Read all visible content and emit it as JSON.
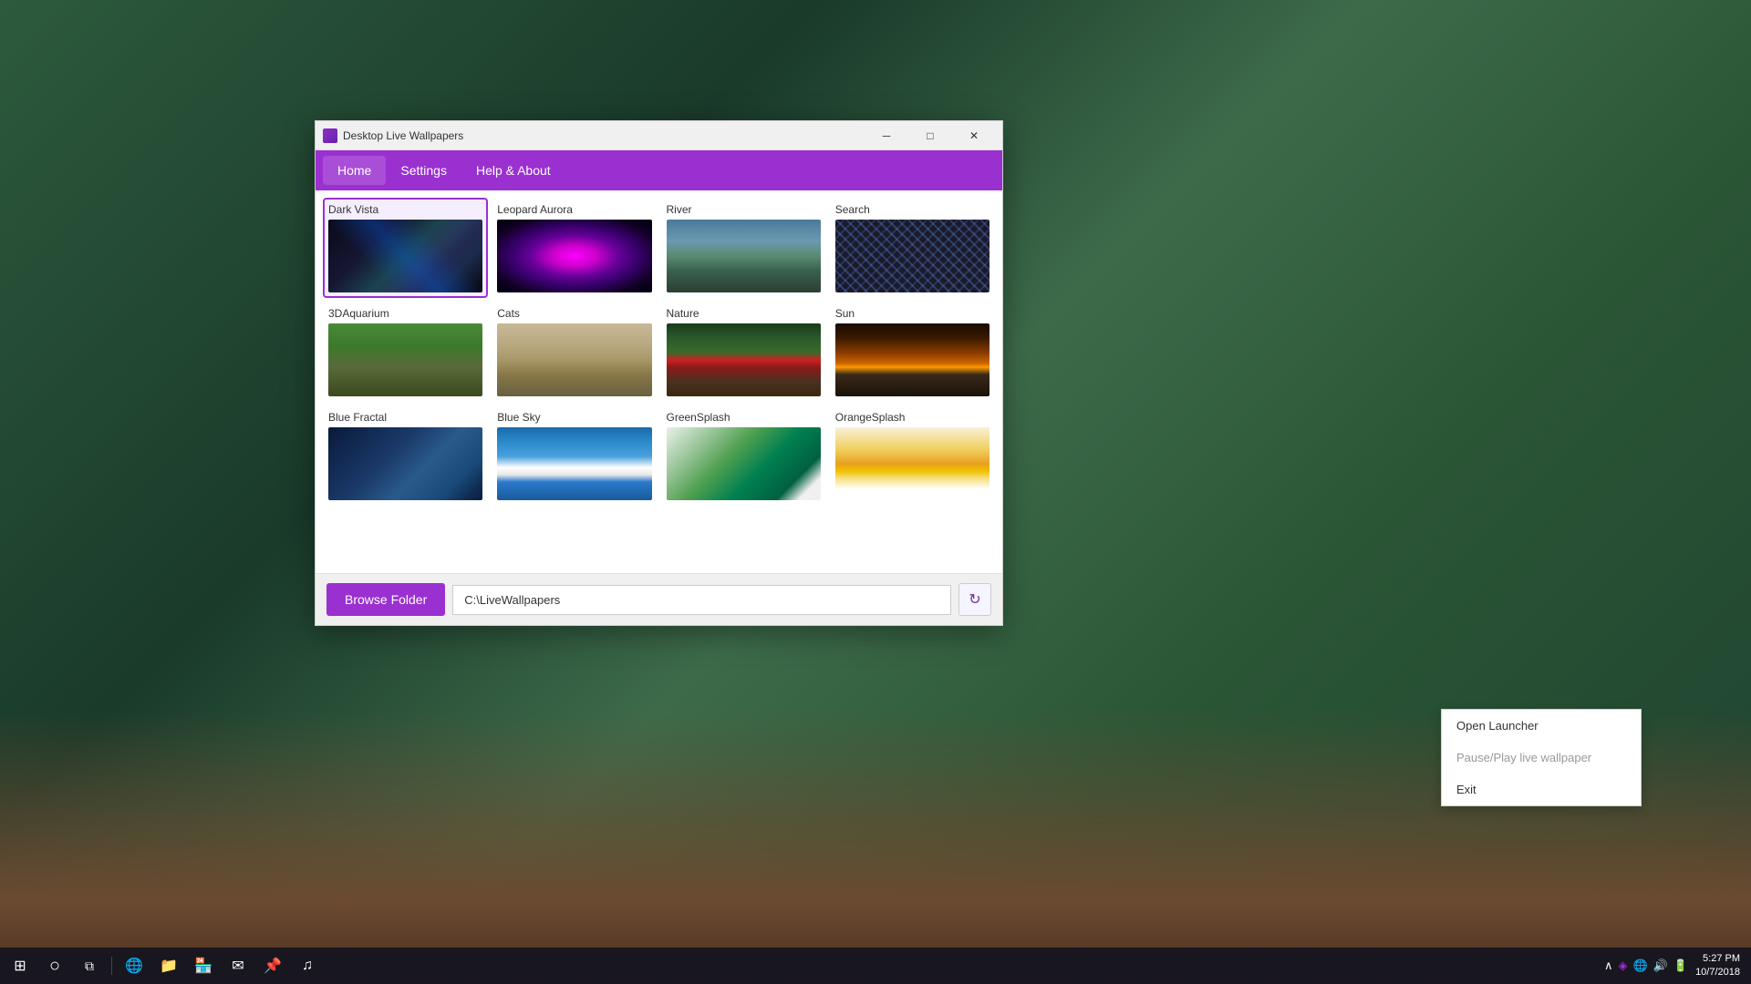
{
  "app": {
    "title": "Desktop Live Wallpapers",
    "title_icon": "wallpaper-icon"
  },
  "nav": {
    "items": [
      {
        "label": "Home",
        "id": "home",
        "active": true
      },
      {
        "label": "Settings",
        "id": "settings",
        "active": false
      },
      {
        "label": "Help & About",
        "id": "help",
        "active": false
      }
    ]
  },
  "wallpapers": [
    {
      "name": "Dark Vista",
      "thumb_class": "thumb-dark-vista"
    },
    {
      "name": "Leopard Aurora",
      "thumb_class": "thumb-leopard-aurora"
    },
    {
      "name": "River",
      "thumb_class": "thumb-river"
    },
    {
      "name": "Search",
      "thumb_class": "thumb-search"
    },
    {
      "name": "3DAquarium",
      "thumb_class": "thumb-3daquarium"
    },
    {
      "name": "Cats",
      "thumb_class": "thumb-cats"
    },
    {
      "name": "Nature",
      "thumb_class": "thumb-nature"
    },
    {
      "name": "Sun",
      "thumb_class": "thumb-sun"
    },
    {
      "name": "Blue Fractal",
      "thumb_class": "thumb-blue-fractal"
    },
    {
      "name": "Blue Sky",
      "thumb_class": "thumb-blue-sky"
    },
    {
      "name": "GreenSplash",
      "thumb_class": "thumb-greensplash"
    },
    {
      "name": "OrangeSplash",
      "thumb_class": "thumb-orangesplash"
    }
  ],
  "bottom_bar": {
    "browse_label": "Browse Folder",
    "path_value": "C:\\LiveWallpapers",
    "path_placeholder": "C:\\LiveWallpapers",
    "refresh_icon": "↻"
  },
  "context_menu": {
    "items": [
      {
        "label": "Open Launcher",
        "id": "open-launcher"
      },
      {
        "label": "Pause/Play live wallpaper",
        "id": "pause-play"
      },
      {
        "label": "Exit",
        "id": "exit"
      }
    ]
  },
  "taskbar": {
    "start_icon": "⊞",
    "time": "5:27 PM",
    "date": "10/7/2018",
    "buttons": [
      {
        "icon": "⊞",
        "name": "start"
      },
      {
        "icon": "○",
        "name": "search"
      },
      {
        "icon": "☰",
        "name": "task-view"
      },
      {
        "icon": "🌐",
        "name": "edge"
      },
      {
        "icon": "📁",
        "name": "file-explorer"
      },
      {
        "icon": "🏪",
        "name": "store"
      },
      {
        "icon": "✉",
        "name": "mail"
      },
      {
        "icon": "📌",
        "name": "pinned1"
      },
      {
        "icon": "🎵",
        "name": "music"
      }
    ]
  },
  "colors": {
    "accent": "#9b30d0",
    "titlebar_bg": "#f0f0f0",
    "nav_bg": "#9b30d0"
  }
}
